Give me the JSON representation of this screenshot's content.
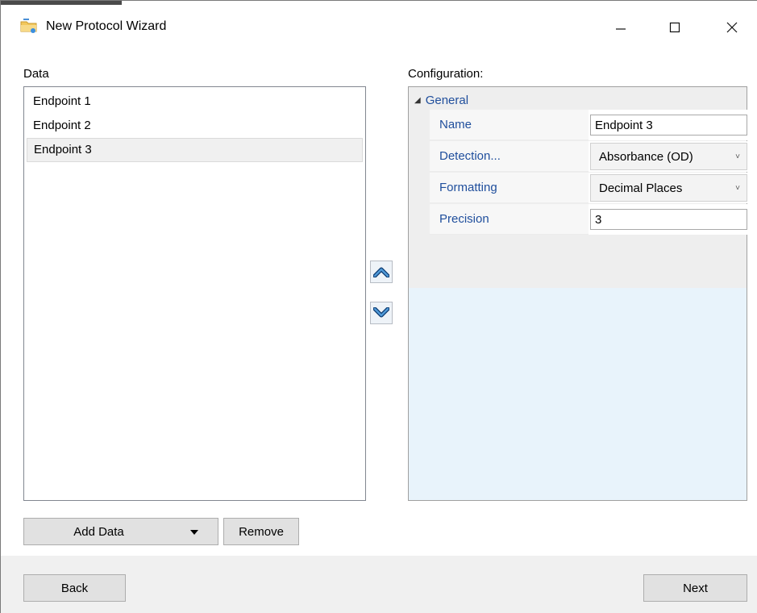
{
  "window": {
    "title": "New Protocol Wizard",
    "icon": "wizard-folder-icon",
    "controls": [
      "minimize-icon",
      "maximize-icon",
      "close-icon"
    ]
  },
  "data_section": {
    "label": "Data",
    "items": [
      {
        "label": "Endpoint 1",
        "selected": false
      },
      {
        "label": "Endpoint 2",
        "selected": false
      },
      {
        "label": "Endpoint 3",
        "selected": true
      }
    ]
  },
  "reorder": {
    "up_icon": "move-up-icon",
    "down_icon": "move-down-icon"
  },
  "configuration": {
    "label": "Configuration:",
    "group": "General",
    "properties": [
      {
        "name": "Name",
        "value": "Endpoint 3",
        "kind": "text"
      },
      {
        "name": "Detection...",
        "value": "Absorbance (OD)",
        "kind": "combo"
      },
      {
        "name": "Formatting",
        "value": "Decimal Places",
        "kind": "combo"
      },
      {
        "name": "Precision",
        "value": "3",
        "kind": "text"
      }
    ]
  },
  "buttons": {
    "add_data": "Add Data",
    "remove": "Remove",
    "back": "Back",
    "next": "Next"
  },
  "colors": {
    "accent_text": "#1f4e9c",
    "config_background": "#e8f3fb",
    "button_face": "#e1e1e1",
    "footer_background": "#f0f0f0"
  }
}
